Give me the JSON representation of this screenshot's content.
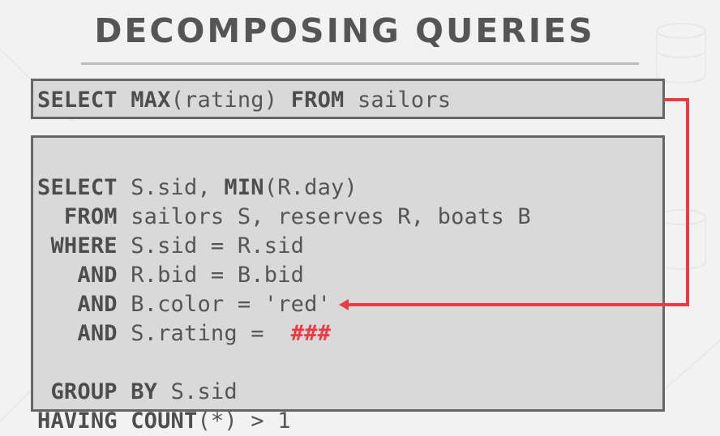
{
  "slide": {
    "title": "DECOMPOSING QUERIES",
    "accent_color": "#ee3b43",
    "outer_query": {
      "tokens": [
        {
          "text": "SELECT",
          "kw": true
        },
        {
          "text": " ",
          "kw": false
        },
        {
          "text": "MAX",
          "kw": true
        },
        {
          "text": "(rating) ",
          "kw": false
        },
        {
          "text": "FROM",
          "kw": true
        },
        {
          "text": " sailors",
          "kw": false
        }
      ]
    },
    "inner_query": {
      "lines": [
        {
          "kw": "SELECT",
          "rest_pre": " S.sid, ",
          "kw2": "MIN",
          "rest": "(R.day)"
        },
        {
          "kw": "  FROM",
          "rest": " sailors S, reserves R, boats B"
        },
        {
          "kw": " WHERE",
          "rest": " S.sid = R.sid"
        },
        {
          "kw": "   AND",
          "rest": " R.bid = B.bid"
        },
        {
          "kw": "   AND",
          "rest": " B.color = 'red'"
        },
        {
          "kw": "   AND",
          "rest": " S.rating =  ",
          "placeholder": "###"
        },
        {
          "kw": "",
          "rest": ""
        },
        {
          "kw": " GROUP BY",
          "rest": " S.sid"
        },
        {
          "kw": "HAVING COUNT",
          "rest": "(*) > 1"
        }
      ]
    }
  }
}
